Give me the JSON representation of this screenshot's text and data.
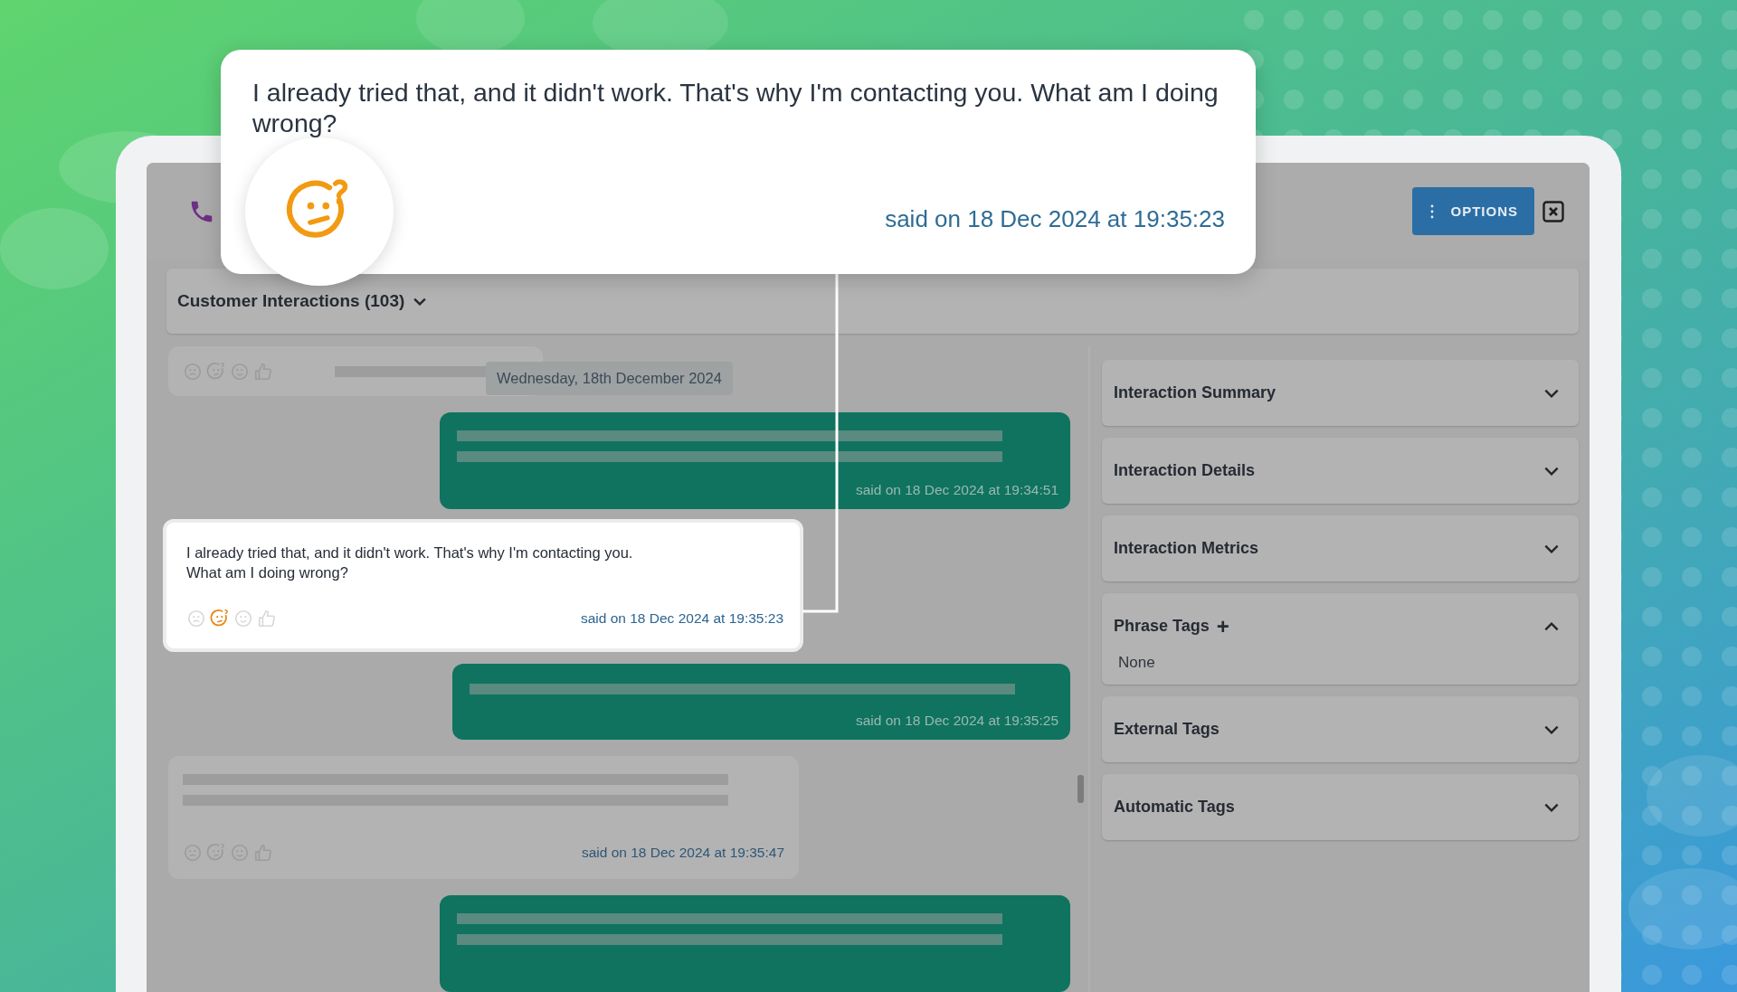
{
  "header": {
    "options_label": "OPTIONS"
  },
  "conversation": {
    "title": "Customer Interactions (103)",
    "date_separator": "Wednesday, 18th December 2024",
    "messages": [
      {
        "kind": "customer-stub",
        "highlighted": false,
        "reactions": [
          {
            "kind": "frown",
            "selected": false
          },
          {
            "kind": "confused",
            "selected": false
          },
          {
            "kind": "smile",
            "selected": false
          },
          {
            "kind": "thumbs-up",
            "selected": false
          }
        ]
      },
      {
        "kind": "agent-tall",
        "timestamp": "said on 18 Dec 2024 at 19:34:51"
      },
      {
        "kind": "customer-text",
        "highlighted": true,
        "text": "I already tried that, and it didn't work. That's why I'm contacting you.\nWhat am I doing wrong?",
        "timestamp": "said on 18 Dec 2024 at 19:35:23",
        "reactions": [
          {
            "kind": "frown",
            "selected": false
          },
          {
            "kind": "confused",
            "selected": true
          },
          {
            "kind": "smile",
            "selected": false
          },
          {
            "kind": "thumbs-up",
            "selected": false
          }
        ]
      },
      {
        "kind": "agent-short",
        "timestamp": "said on 18 Dec 2024 at 19:35:25"
      },
      {
        "kind": "customer-tall",
        "highlighted": false,
        "timestamp": "said on 18 Dec 2024 at 19:35:47",
        "reactions": [
          {
            "kind": "frown",
            "selected": false
          },
          {
            "kind": "confused",
            "selected": false
          },
          {
            "kind": "smile",
            "selected": false
          },
          {
            "kind": "thumbs-up",
            "selected": false
          }
        ]
      },
      {
        "kind": "agent-tall"
      }
    ]
  },
  "panel": {
    "sections": [
      {
        "title": "Interaction Summary",
        "expanded": false
      },
      {
        "title": "Interaction Details",
        "expanded": false
      },
      {
        "title": "Interaction Metrics",
        "expanded": false
      },
      {
        "title": "Phrase Tags",
        "action": "+",
        "expanded": true,
        "content": "None"
      },
      {
        "title": "External Tags",
        "expanded": false
      },
      {
        "title": "Automatic Tags",
        "expanded": false
      }
    ]
  },
  "callout": {
    "text": "I already tried that, and it didn't work. That's why I'm contacting you. What am I doing wrong?",
    "timestamp": "said on 18 Dec 2024 at 19:35:23"
  }
}
